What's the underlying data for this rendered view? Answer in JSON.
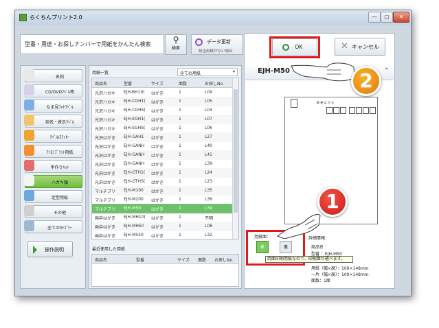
{
  "window": {
    "title": "らくちんプリント2.0",
    "min_label": "—",
    "max_label": "▢",
    "close_label": "✕"
  },
  "search": {
    "placeholder": "型番・用途・お探しナンバーで用紙をかんたん検索",
    "search_label": "検索",
    "update_label": "データ更新",
    "update_sub": "該当用紙がない場合"
  },
  "sidebar": {
    "items": [
      {
        "label": "名刺",
        "color": "#e8e8e8"
      },
      {
        "label": "CD/DVDﾗﾍﾞﾙ等",
        "color": "#d8d0e8"
      },
      {
        "label": "なま見ﾌｫﾄﾗﾍﾞﾙ",
        "color": "#7faee6"
      },
      {
        "label": "宛名・表示ﾗﾍﾞﾙ",
        "color": "#f2c56b"
      },
      {
        "label": "ﾗﾍﾞﾙ/ｽﾃｯｶｰ",
        "color": "#f0a430"
      },
      {
        "label": "ｱｲﾛﾝﾌﾟﾘﾝﾄ用紙",
        "color": "#f58e2f"
      },
      {
        "label": "手作りｷｯﾄ",
        "color": "#e46d6d"
      },
      {
        "label": "ハガキ類",
        "color": "#f4f4f4"
      },
      {
        "label": "定型用紙",
        "color": "#6fa9dc"
      },
      {
        "label": "その他",
        "color": "#cfcfcf"
      },
      {
        "label": "全てのｶﾃｺﾞﾘｰ",
        "color": "#9fb7cf"
      }
    ],
    "guide_label": "操作説明"
  },
  "list": {
    "title": "用紙一覧",
    "filter": "全ての用紙",
    "headers": [
      "商品名",
      "型番",
      "サイズ",
      "面数",
      "お探しNo."
    ],
    "rows": [
      [
        "光沢ハガキ",
        "EJH-BH10(",
        "はがき",
        "1",
        "L09"
      ],
      [
        "光沢ハガキ",
        "EJH-CGH1(",
        "はがき",
        "1",
        "L05"
      ],
      [
        "光沢ハガキ",
        "EJH-CGHS(",
        "はがき",
        "1",
        "L04"
      ],
      [
        "光沢ハガキ",
        "EJH-EGH1(",
        "はがき",
        "1",
        "L07"
      ],
      [
        "光沢ハガキ",
        "EJH-EGHS(",
        "はがき",
        "1",
        "L06"
      ],
      [
        "光沢はがき",
        "EJH-GAH1",
        "はがき",
        "1",
        "L27"
      ],
      [
        "光沢はがき",
        "EJH-GANH",
        "はがき",
        "1",
        "L40"
      ],
      [
        "光沢はがき",
        "EJH-GANH",
        "はがき",
        "1",
        "L41"
      ],
      [
        "光沢はがき",
        "EJH-GANH",
        "はがき",
        "1",
        "L39"
      ],
      [
        "光沢はがき",
        "EJH-GTH1(",
        "はがき",
        "1",
        "L24"
      ],
      [
        "光沢はがき",
        "EJH-GTHS(",
        "はがき",
        "1",
        "L23"
      ],
      [
        "マルチプリ",
        "EJH-M100",
        "はがき",
        "1",
        "L35"
      ],
      [
        "マルチプリ",
        "EJH-M200",
        "はがき",
        "1",
        "L36"
      ],
      [
        "マルチプリ",
        "EJH-M50",
        "はがき",
        "1",
        "L34"
      ],
      [
        "画中はがき",
        "EJH-MH10(",
        "はがき",
        "1",
        "不明"
      ],
      [
        "画中はがき",
        "EJH-MH50",
        "はがき",
        "1",
        "L08"
      ],
      [
        "画中はがき",
        "EJH-MS50",
        "はがき",
        "1",
        "L32"
      ]
    ],
    "selected_index": 13,
    "recent_title": "最近使用した用紙",
    "recent_headers": [
      "商品名",
      "型番",
      "サイズ",
      "面数",
      "お探しNo."
    ]
  },
  "preview": {
    "ok_label": "OK",
    "cancel_label": "キャンセル",
    "model": "EJH-M50",
    "postcard_label": "郵 便 は が き",
    "side_label": "用紙面：",
    "front_label": "表",
    "back_label": "裏",
    "tooltip": "両面印刷用紙なので、印刷面が選べます。",
    "detail_title": "詳細情報：",
    "details": [
      "商品名 ：",
      "型番 ：EJH-M50",
      "用紙（幅×高）：100×148mm",
      "一片（幅×高）：100×148mm",
      "面数：1面"
    ]
  },
  "badges": {
    "one": "1",
    "two": "2"
  }
}
